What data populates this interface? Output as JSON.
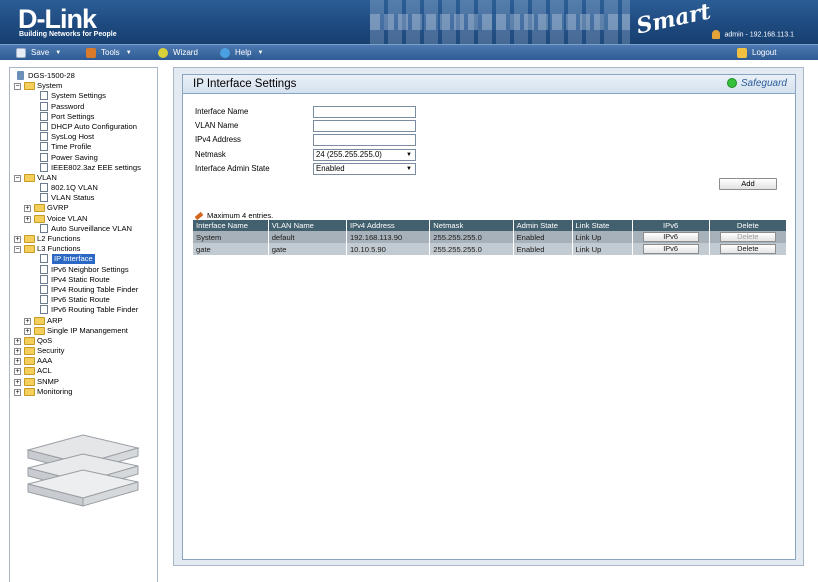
{
  "header": {
    "brand": "D-Link",
    "tagline": "Building Networks for People",
    "product_logo": "Smart",
    "user_info": "admin - 192.168.113.1"
  },
  "menubar": {
    "save": "Save",
    "tools": "Tools",
    "wizard": "Wizard",
    "help": "Help",
    "logout": "Logout"
  },
  "sidebar": {
    "root": "DGS-1500-28",
    "nodes": [
      {
        "label": "System",
        "type": "folder",
        "expanded": true
      },
      {
        "label": "System Settings",
        "type": "page"
      },
      {
        "label": "Password",
        "type": "page"
      },
      {
        "label": "Port Settings",
        "type": "page"
      },
      {
        "label": "DHCP Auto Configuration",
        "type": "page"
      },
      {
        "label": "SysLog Host",
        "type": "page"
      },
      {
        "label": "Time Profile",
        "type": "page"
      },
      {
        "label": "Power Saving",
        "type": "page"
      },
      {
        "label": "IEEE802.3az EEE settings",
        "type": "page"
      },
      {
        "label": "VLAN",
        "type": "folder",
        "expanded": true
      },
      {
        "label": "802.1Q VLAN",
        "type": "page"
      },
      {
        "label": "VLAN Status",
        "type": "page"
      },
      {
        "label": "GVRP",
        "type": "folder",
        "expanded": false
      },
      {
        "label": "Voice VLAN",
        "type": "folder",
        "expanded": false
      },
      {
        "label": "Auto Surveillance VLAN",
        "type": "page"
      },
      {
        "label": "L2 Functions",
        "type": "folder",
        "expanded": false
      },
      {
        "label": "L3 Functions",
        "type": "folder",
        "expanded": true
      },
      {
        "label": "IP Interface",
        "type": "page",
        "selected": true
      },
      {
        "label": "IPv6 Neighbor Settings",
        "type": "page"
      },
      {
        "label": "IPv4 Static Route",
        "type": "page"
      },
      {
        "label": "IPv4 Routing Table Finder",
        "type": "page"
      },
      {
        "label": "IPv6 Static Route",
        "type": "page"
      },
      {
        "label": "IPv6 Routing Table Finder",
        "type": "page"
      },
      {
        "label": "ARP",
        "type": "folder",
        "expanded": false
      },
      {
        "label": "Single IP Manangement",
        "type": "folder",
        "expanded": false
      },
      {
        "label": "QoS",
        "type": "folder",
        "expanded": false
      },
      {
        "label": "Security",
        "type": "folder",
        "expanded": false
      },
      {
        "label": "AAA",
        "type": "folder",
        "expanded": false
      },
      {
        "label": "ACL",
        "type": "folder",
        "expanded": false
      },
      {
        "label": "SNMP",
        "type": "folder",
        "expanded": false
      },
      {
        "label": "Monitoring",
        "type": "folder",
        "expanded": false
      }
    ]
  },
  "panel": {
    "title": "IP Interface Settings",
    "safeguard": "Safeguard"
  },
  "form": {
    "interface_name_label": "Interface Name",
    "interface_name_value": "",
    "vlan_name_label": "VLAN Name",
    "vlan_name_value": "",
    "ipv4_address_label": "IPv4 Address",
    "ipv4_address_value": "",
    "netmask_label": "Netmask",
    "netmask_value": "24 (255.255.255.0)",
    "admin_state_label": "Interface Admin State",
    "admin_state_value": "Enabled",
    "add_button": "Add"
  },
  "note": "Maximum 4 entries.",
  "table": {
    "headers": [
      "Interface Name",
      "VLAN Name",
      "IPv4 Address",
      "Netmask",
      "Admin State",
      "Link State",
      "IPv6",
      "Delete"
    ],
    "rows": [
      {
        "interface": "System",
        "vlan": "default",
        "ipv4": "192.168.113.90",
        "netmask": "255.255.255.0",
        "admin_state": "Enabled",
        "link_state": "Link Up",
        "ipv6_button": "IPv6",
        "delete_button": "Delete",
        "delete_enabled": false
      },
      {
        "interface": "gate",
        "vlan": "gate",
        "ipv4": "10.10.5.90",
        "netmask": "255.255.255.0",
        "admin_state": "Enabled",
        "link_state": "Link Up",
        "ipv6_button": "IPv6",
        "delete_button": "Delete",
        "delete_enabled": true
      }
    ]
  },
  "colors": {
    "header_blue": "#1e4a80",
    "table_header": "#43606f",
    "safeguard_green": "#35c23a",
    "selected_node": "#2b68c4"
  }
}
